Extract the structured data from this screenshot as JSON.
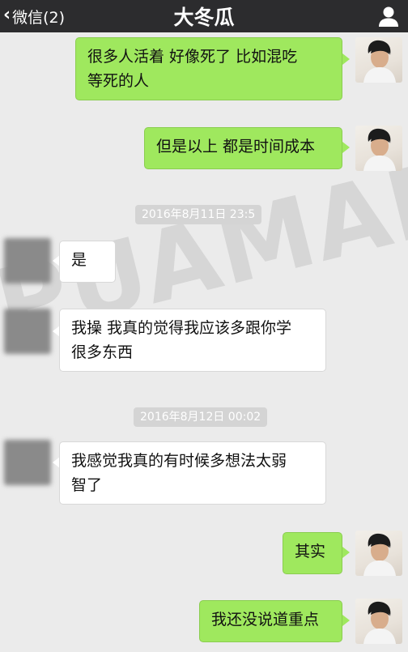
{
  "header": {
    "back_label": "微信(2)",
    "title": "大冬瓜",
    "profile_icon": "person-icon"
  },
  "messages": [
    {
      "type": "sent",
      "text_lines": [
        "很多人活着 好像死了 比如混吃",
        "等死的人"
      ]
    },
    {
      "type": "sent",
      "text_lines": [
        "但是以上 都是时间成本"
      ]
    },
    {
      "type": "timestamp",
      "text": "2016年8月11日 23:5"
    },
    {
      "type": "received",
      "text_lines": [
        "是"
      ]
    },
    {
      "type": "received",
      "text_lines": [
        "我操 我真的觉得我应该多跟你学",
        "很多东西"
      ]
    },
    {
      "type": "timestamp",
      "text": "2016年8月12日 00:02"
    },
    {
      "type": "received",
      "text_lines": [
        "我感觉我真的有时候多想法太弱",
        "智了"
      ]
    },
    {
      "type": "sent",
      "text_lines": [
        "其实"
      ]
    },
    {
      "type": "sent",
      "text_lines": [
        "我还没说道重点"
      ]
    }
  ],
  "watermark": "PUAMAP",
  "colors": {
    "header_bg": "#2c2c2e",
    "chat_bg": "#ebebeb",
    "sent_bubble": "#9fe85e",
    "received_bubble": "#ffffff",
    "timestamp_bg": "#d4d4d4"
  }
}
